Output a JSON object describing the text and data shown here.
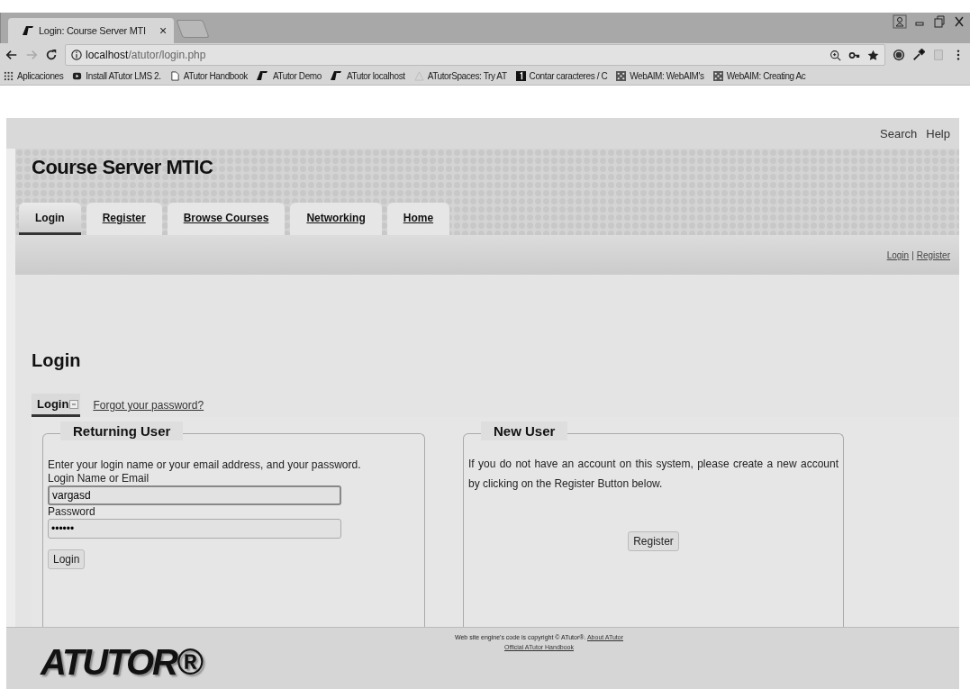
{
  "browser": {
    "tab_title": "Login: Course Server MTI",
    "tab_close": "×",
    "address_host": "localhost",
    "address_path": "/atutor/login.php",
    "bookmarks": [
      {
        "kind": "apps",
        "label": "Aplicaciones"
      },
      {
        "kind": "play",
        "label": "Install ATutor LMS 2."
      },
      {
        "kind": "page",
        "label": "ATutor Handbook"
      },
      {
        "kind": "at",
        "label": "ATutor Demo"
      },
      {
        "kind": "at",
        "label": "ATutor localhost"
      },
      {
        "kind": "spaces",
        "label": "ATutorSpaces: Try AT"
      },
      {
        "kind": "one",
        "label": "Contar caracteres / C"
      },
      {
        "kind": "webaim",
        "label": "WebAIM: WebAIM's"
      },
      {
        "kind": "webaim",
        "label": "WebAIM: Creating Ac"
      }
    ]
  },
  "top_links": [
    "Search",
    "Help"
  ],
  "site_title": "Course Server MTIC",
  "nav_tabs": [
    {
      "label": "Login",
      "selected": true
    },
    {
      "label": "Register",
      "selected": false
    },
    {
      "label": "Browse Courses",
      "selected": false
    },
    {
      "label": "Networking",
      "selected": false
    },
    {
      "label": "Home",
      "selected": false
    }
  ],
  "user_links": [
    "Login",
    "|",
    "Register"
  ],
  "page_heading": "Login",
  "sub_tabs": [
    {
      "label": "Login",
      "selected": true
    },
    {
      "label": "Forgot your password?",
      "selected": false
    }
  ],
  "returning_user": {
    "legend": "Returning User",
    "intro": "Enter your login name or your email address, and your password.",
    "login_label": "Login Name or Email",
    "login_value": "vargasd",
    "password_label": "Password",
    "password_value": "••••••",
    "button": "Login"
  },
  "new_user": {
    "legend": "New User",
    "intro": "If you do not have an account on this system, please create a new account by clicking on the Register Button below.",
    "button": "Register"
  },
  "footer": {
    "logo": "ATUTOR®",
    "copyright": "Web site engine's code is copyright © ATutor®.",
    "about_link": "About ATutor",
    "handbook_link": "Official ATutor Handbook"
  }
}
